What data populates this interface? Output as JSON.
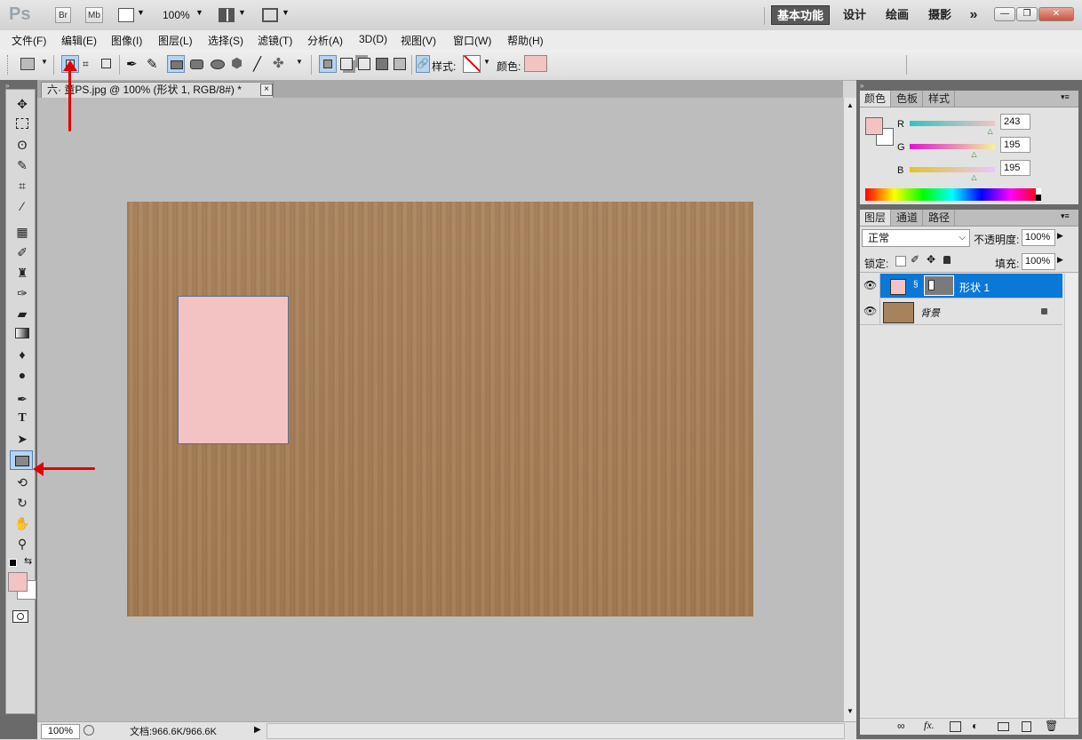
{
  "app": {
    "logo": "Ps",
    "bridge_btn": "Br",
    "minibridge_btn": "Mb",
    "zoom_level": "100%",
    "workspaces": [
      "基本功能",
      "设计",
      "绘画",
      "摄影"
    ],
    "more_glyph": "»"
  },
  "menu": [
    "文件(F)",
    "编辑(E)",
    "图像(I)",
    "图层(L)",
    "选择(S)",
    "滤镜(T)",
    "分析(A)",
    "3D(D)",
    "视图(V)",
    "窗口(W)",
    "帮助(H)"
  ],
  "options": {
    "style_label": "样式:",
    "color_label": "颜色:",
    "shape_color": "#f3c3c3"
  },
  "document": {
    "tab_title": "六·  童PS.jpg @ 100% (形状 1, RGB/8#) *",
    "close_glyph": "×"
  },
  "status": {
    "zoom": "100%",
    "doc_info": "文档:966.6K/966.6K"
  },
  "color_panel": {
    "tabs": [
      "颜色",
      "色板",
      "样式"
    ],
    "r_label": "R",
    "g_label": "G",
    "b_label": "B",
    "r": "243",
    "g": "195",
    "b": "195",
    "r_level": 243,
    "g_level": 195,
    "b_level": 195
  },
  "layers_panel": {
    "tabs": [
      "图层",
      "通道",
      "路径"
    ],
    "blend_mode": "正常",
    "opacity_label": "不透明度:",
    "opacity": "100%",
    "lock_label": "锁定:",
    "fill_label": "填充:",
    "fill": "100%",
    "layers": [
      {
        "name": "形状 1",
        "selected": true
      },
      {
        "name": "背景",
        "selected": false
      }
    ],
    "bottom_icons": [
      "link-icon",
      "fx-icon",
      "mask-icon",
      "adjustment-icon",
      "folder-icon",
      "new-layer-icon",
      "trash-icon"
    ]
  },
  "toolbox": {
    "tools": [
      "move-icon",
      "marquee-icon",
      "lasso-icon",
      "quick-select-icon",
      "crop-icon",
      "eyedropper-icon",
      "healing-icon",
      "brush-icon",
      "stamp-icon",
      "history-brush-icon",
      "eraser-icon",
      "gradient-icon",
      "blur-icon",
      "dodge-icon",
      "pen-icon",
      "type-icon",
      "path-select-icon",
      "rectangle-icon",
      "3d-rotate-icon",
      "3d-orbit-icon",
      "hand-icon",
      "zoom-icon"
    ],
    "type_glyph": "T"
  },
  "colors": {
    "foreground": "#f3c3c3",
    "background": "#ffffff",
    "selection_blue": "#0a78d6",
    "arrow_red": "#e00000"
  }
}
